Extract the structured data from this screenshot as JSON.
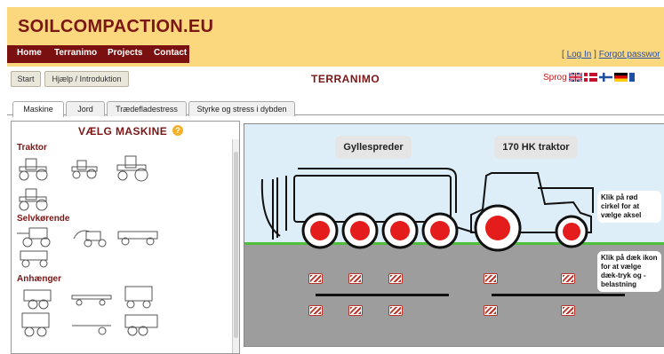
{
  "header": {
    "logo_main": "SOILCOMPACTION",
    "logo_suffix": ".EU",
    "nav": [
      "Home",
      "Terranimo",
      "Projects",
      "Contact"
    ],
    "auth_bracket_open": "[",
    "login": "Log In",
    "bracket_close": "]",
    "forgot": "Forgot passwor"
  },
  "toolbar": {
    "start_label": "Start",
    "help_label": "Hjælp / Introduktion",
    "title": "TERRANIMO",
    "sprog": "Sprog"
  },
  "tabs": [
    "Maskine",
    "Jord",
    "Trædefladestress",
    "Styrke og stress i dybden"
  ],
  "leftpanel": {
    "title": "VÆLG MASKINE",
    "help_icon": "?",
    "categories": [
      "Traktor",
      "Selvkørende",
      "Anhænger"
    ]
  },
  "scene": {
    "label_left": "Gyllespreder",
    "label_right": "170 HK traktor",
    "hint_axle": "Klik på rød cirkel for at vælge aksel",
    "hint_tire": "Klik på dæk ikon for at vælge dæk-tryk og -belastning"
  },
  "colors": {
    "header_bg": "#fbd77e",
    "brand": "#7a1616",
    "nav_bg": "#7a1010",
    "wheel_red": "#e51c1c",
    "grass": "#4fbf3a",
    "ground": "#9d9d9d"
  },
  "icons": [
    "help-icon",
    "flag-uk",
    "flag-denmark",
    "flag-finland",
    "flag-germany",
    "flag-france"
  ]
}
